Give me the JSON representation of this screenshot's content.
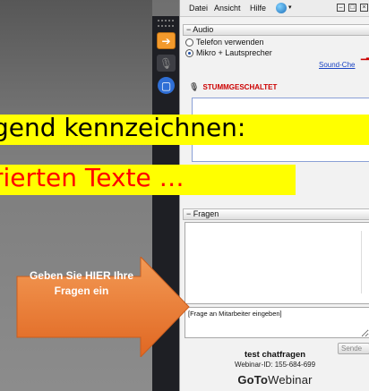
{
  "menu": {
    "file": "Datei",
    "view": "Ansicht",
    "help": "Hilfe",
    "help_icon": "globe-help-icon"
  },
  "window_controls": [
    "minimize-icon",
    "restore-icon",
    "close-icon"
  ],
  "sidebar": {
    "buttons": [
      "share-screen-icon",
      "microphone-icon",
      "screen-icon"
    ]
  },
  "audio": {
    "section_title": "Audio",
    "options": [
      {
        "label": "Telefon verwenden",
        "selected": false
      },
      {
        "label": "Mikro + Lautsprecher",
        "selected": true
      }
    ],
    "sound_link": "Sound-Che",
    "mute_status": "STUMMGESCHALTET"
  },
  "questions": {
    "section_title": "Fragen",
    "input_value": "[Frage an Mitarbeiter eingeben]",
    "send_label": "Sende"
  },
  "session": {
    "title": "test  chatfragen",
    "webinar_id": "Webinar-ID: 155-684-699",
    "brand_bold": "GoTo",
    "brand_regular": "Webinar"
  },
  "overlay": {
    "caption_line1": "gend kennzeichnen:",
    "caption_line2": "rierten Texte …",
    "callout_text": "Geben Sie HIER Ihre Fragen ein",
    "caption1_bg": "#ffff00",
    "caption2_color": "#ff0000",
    "callout_color": "#f07a2b"
  }
}
